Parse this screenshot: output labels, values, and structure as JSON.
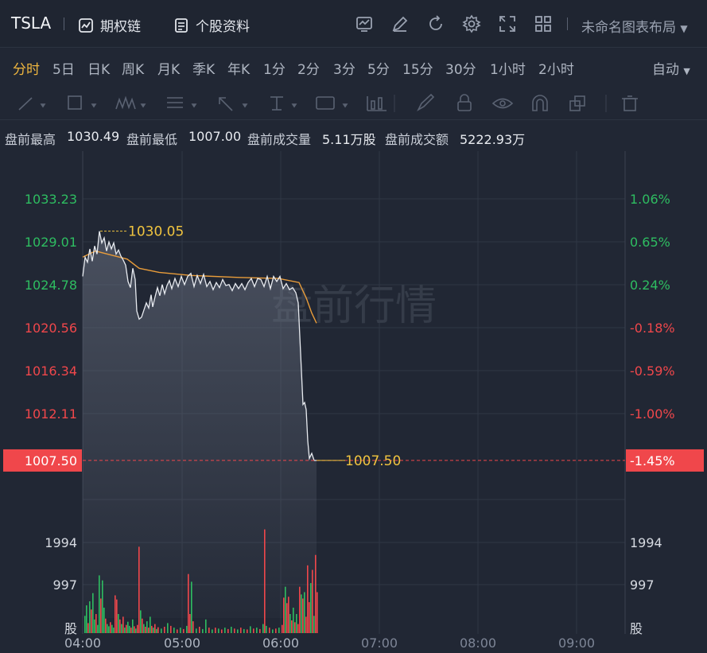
{
  "header": {
    "ticker": "TSLA",
    "options_chain": "期权链",
    "stock_info": "个股资料",
    "layout_name": "未命名图表布局"
  },
  "periods": [
    {
      "label": "分时",
      "active": true
    },
    {
      "label": "5日"
    },
    {
      "label": "日K"
    },
    {
      "label": "周K"
    },
    {
      "label": "月K"
    },
    {
      "label": "季K"
    },
    {
      "label": "年K"
    },
    {
      "label": "1分"
    },
    {
      "label": "2分"
    },
    {
      "label": "3分"
    },
    {
      "label": "5分"
    },
    {
      "label": "15分"
    },
    {
      "label": "30分"
    },
    {
      "label": "1小时"
    },
    {
      "label": "2小时"
    }
  ],
  "auto_label": "自动",
  "info": {
    "high_label": "盘前最高",
    "high": "1030.49",
    "low_label": "盘前最低",
    "low": "1007.00",
    "vol_label": "盘前成交量",
    "vol": "5.11万股",
    "amt_label": "盘前成交额",
    "amt": "5222.93万"
  },
  "chart_data": {
    "type": "line",
    "watermark": "盘前行情",
    "x_ticks": [
      "04:00",
      "05:00",
      "06:00",
      "07:00",
      "08:00",
      "09:00"
    ],
    "y_ticks": [
      "1033.23",
      "1029.01",
      "1024.78",
      "1020.56",
      "1016.34",
      "1012.11"
    ],
    "pct_ticks": [
      "1.06%",
      "0.65%",
      "0.24%",
      "-0.18%",
      "-0.59%",
      "-1.00%"
    ],
    "current_price": "1007.50",
    "current_pct": "-1.45%",
    "peak_label": "1030.05",
    "last_label": "1007.50",
    "volume_ticks": [
      "1994",
      "997"
    ],
    "volume_unit": "股",
    "colors": {
      "up": "#2ebd61",
      "down": "#f0474b",
      "price": "#e8ebf0",
      "avg": "#e89c3a",
      "label": "#f0c43f"
    }
  }
}
